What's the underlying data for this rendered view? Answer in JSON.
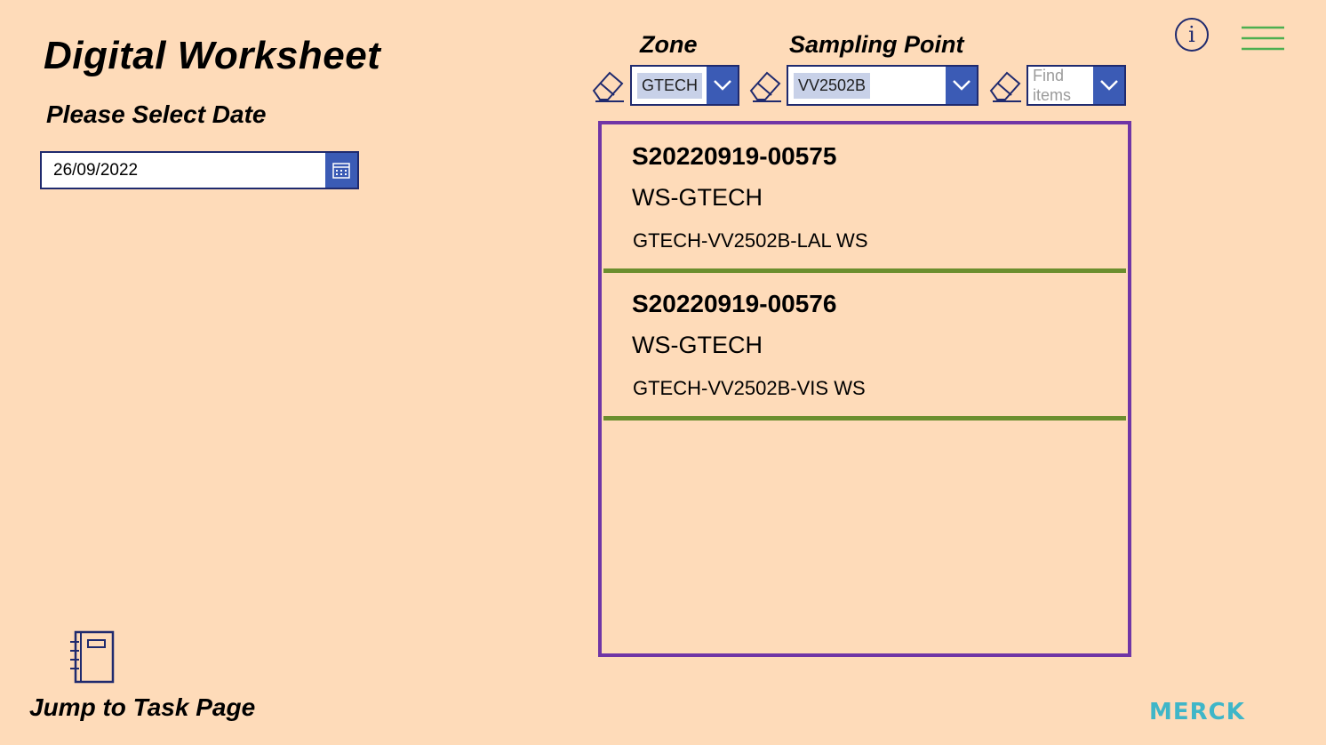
{
  "header": {
    "title": "Digital Worksheet",
    "date_label": "Please Select Date",
    "date_value": "26/09/2022"
  },
  "filters": {
    "zone_label": "Zone",
    "zone_value": "GTECH",
    "sampling_label": "Sampling Point",
    "sampling_value": "VV2502B",
    "find_placeholder_line1": "Find",
    "find_placeholder_line2": "items"
  },
  "gallery": {
    "items": [
      {
        "id": "S20220919-00575",
        "worksheet": "WS-GTECH",
        "point": "GTECH-VV2502B-LAL WS"
      },
      {
        "id": "S20220919-00576",
        "worksheet": "WS-GTECH",
        "point": "GTECH-VV2502B-VIS WS"
      }
    ]
  },
  "info": {
    "glyph": "i"
  },
  "footer": {
    "jump_label": "Jump to Task Page",
    "logo_text": "MERCK"
  },
  "colors": {
    "background": "#fedbb9",
    "accent_blue": "#3b5bb5",
    "border_navy": "#1f2a6e",
    "gallery_border": "#7035a6",
    "separator": "#6b8e2e",
    "menu": "#4caf50",
    "logo": "#3fb6c8"
  },
  "icons": [
    "calendar-icon",
    "eraser-icon",
    "chevron-down-icon",
    "info-icon",
    "hamburger-menu-icon",
    "notebook-icon"
  ]
}
